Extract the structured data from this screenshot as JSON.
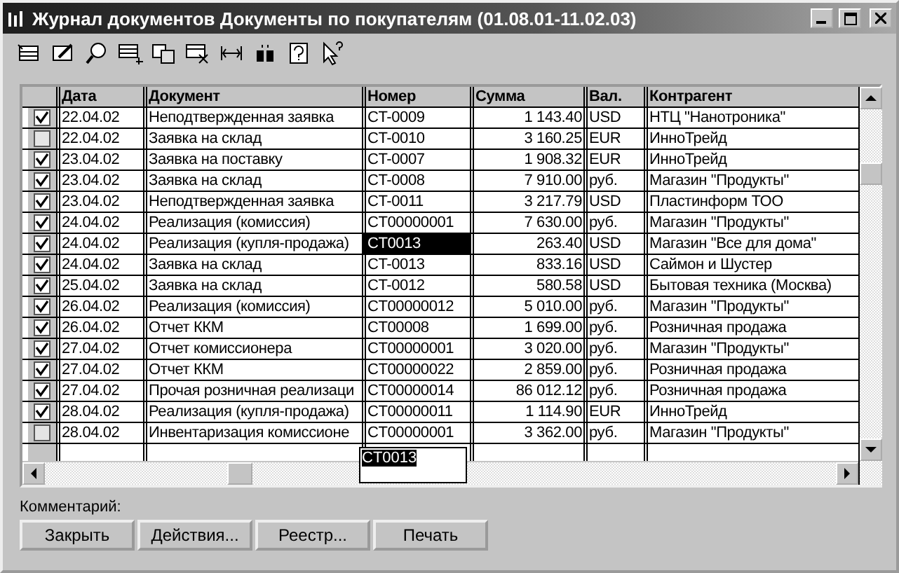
{
  "window": {
    "title": "Журнал документов  Документы по покупателям (01.08.01-11.02.03)"
  },
  "table": {
    "columns": [
      "Дата",
      "Документ",
      "Номер",
      "Сумма",
      "Вал.",
      "Контрагент"
    ],
    "rows": [
      {
        "posted": true,
        "selected": false,
        "cells": [
          "22.04.02",
          "Неподтвержденная заявка",
          "CT-0009",
          "1 143.40",
          "USD",
          "НТЦ \"Нанотроника\""
        ]
      },
      {
        "posted": false,
        "selected": false,
        "cells": [
          "22.04.02",
          "Заявка на склад",
          "CT-0010",
          "3 160.25",
          "EUR",
          "ИнноТрейд"
        ]
      },
      {
        "posted": true,
        "selected": false,
        "cells": [
          "23.04.02",
          "Заявка на поставку",
          "CT-0007",
          "1 908.32",
          "EUR",
          "ИнноТрейд"
        ]
      },
      {
        "posted": true,
        "selected": false,
        "cells": [
          "23.04.02",
          "Заявка на склад",
          "CT-0008",
          "7 910.00",
          "руб.",
          "Магазин \"Продукты\""
        ]
      },
      {
        "posted": true,
        "selected": false,
        "cells": [
          "23.04.02",
          "Неподтвержденная заявка",
          "CT-0011",
          "3 217.79",
          "USD",
          "Пластинформ ТОО"
        ]
      },
      {
        "posted": true,
        "selected": false,
        "cells": [
          "24.04.02",
          "Реализация (комиссия)",
          "CT00000001",
          "7 630.00",
          "руб.",
          "Магазин \"Продукты\""
        ]
      },
      {
        "posted": true,
        "selected": true,
        "cells": [
          "24.04.02",
          "Реализация (купля-продажа)",
          "CT0013",
          "263.40",
          "USD",
          "Магазин \"Все для дома\""
        ]
      },
      {
        "posted": true,
        "selected": false,
        "cells": [
          "24.04.02",
          "Заявка на склад",
          "CT-0013",
          "833.16",
          "USD",
          "Саймон и Шустер"
        ]
      },
      {
        "posted": true,
        "selected": false,
        "cells": [
          "25.04.02",
          "Заявка на склад",
          "CT-0012",
          "580.58",
          "USD",
          "Бытовая техника (Москва)"
        ]
      },
      {
        "posted": true,
        "selected": false,
        "cells": [
          "26.04.02",
          "Реализация (комиссия)",
          "CT00000012",
          "5 010.00",
          "руб.",
          "Магазин \"Продукты\""
        ]
      },
      {
        "posted": true,
        "selected": false,
        "cells": [
          "26.04.02",
          "Отчет ККМ",
          "CT00008",
          "1 699.00",
          "руб.",
          "Розничная продажа"
        ]
      },
      {
        "posted": true,
        "selected": false,
        "cells": [
          "27.04.02",
          "Отчет комиссионера",
          "CT00000001",
          "3 020.00",
          "руб.",
          "Магазин \"Продукты\""
        ]
      },
      {
        "posted": true,
        "selected": false,
        "cells": [
          "27.04.02",
          "Отчет ККМ",
          "CT00000022",
          "2 859.00",
          "руб.",
          "Розничная продажа"
        ]
      },
      {
        "posted": true,
        "selected": false,
        "cells": [
          "27.04.02",
          "Прочая розничная реализаци",
          "CT00000014",
          "86 012.12",
          "руб.",
          "Розничная продажа"
        ]
      },
      {
        "posted": true,
        "selected": false,
        "cells": [
          "28.04.02",
          "Реализация (купля-продажа)",
          "CT00000011",
          "1 114.90",
          "EUR",
          "ИнноТрейд"
        ]
      },
      {
        "posted": false,
        "selected": false,
        "cells": [
          "28.04.02",
          "Инвентаризация комиссионе",
          "CT00000001",
          "3 362.00",
          "руб.",
          "Магазин \"Продукты\""
        ]
      }
    ]
  },
  "dropdown": {
    "value": "CT0013"
  },
  "comment": {
    "label": "Комментарий:"
  },
  "buttons": [
    {
      "label": "Закрыть"
    },
    {
      "label": "Действия..."
    },
    {
      "label": "Реестр..."
    },
    {
      "label": "Печать"
    }
  ]
}
